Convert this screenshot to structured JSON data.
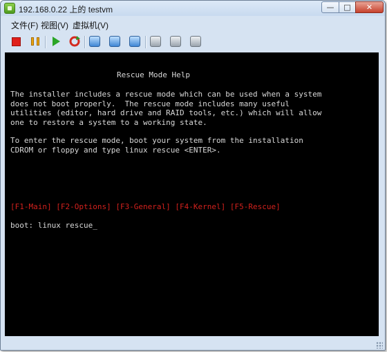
{
  "window": {
    "title": "192.168.0.22 上的 testvm"
  },
  "title_buttons": {
    "minimize": "—",
    "maximize": "□",
    "close": "✕"
  },
  "menu": {
    "items": [
      "文件(F)",
      "视图(V)",
      "虚拟机(V)"
    ]
  },
  "toolbar": {
    "icons": [
      "stop-icon",
      "pause-icon",
      "play-icon",
      "reset-icon",
      "snapshot-icon",
      "revert-snapshot-icon",
      "manage-snapshot-icon",
      "cd-icon",
      "floppy-icon",
      "network-icon"
    ]
  },
  "console": {
    "title": "Rescue Mode Help",
    "paragraph1": "The installer includes a rescue mode which can be used when a system\ndoes not boot properly.  The rescue mode includes many useful\nutilities (editor, hard drive and RAID tools, etc.) which will allow\none to restore a system to a working state.",
    "paragraph2": "To enter the rescue mode, boot your system from the installation\nCDROM or floppy and type linux rescue <ENTER>.",
    "function_keys": "[F1-Main] [F2-Options] [F3-General] [F4-Kernel] [F5-Rescue]",
    "prompt": "boot: linux rescue_"
  },
  "colors": {
    "console_background": "#000000",
    "console_text": "#d8d8d8",
    "function_keys": "#d2211d",
    "chrome": "#d6e3f2"
  }
}
